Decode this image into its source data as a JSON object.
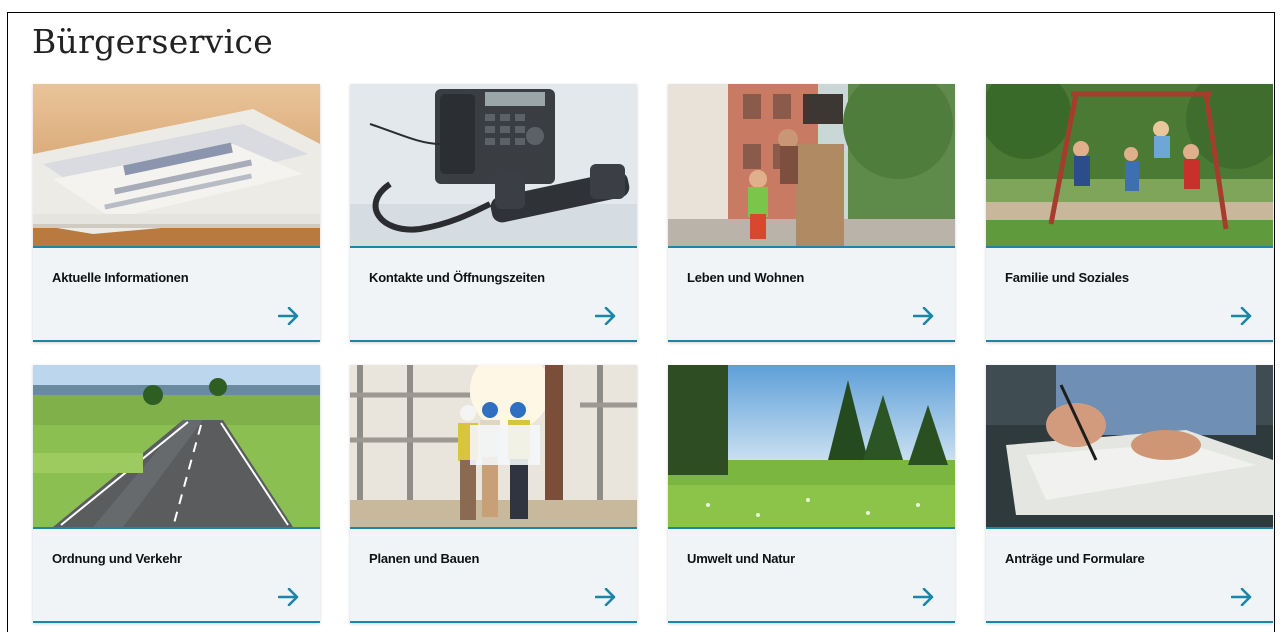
{
  "page": {
    "title": "Bürgerservice"
  },
  "colors": {
    "accent": "#1b86a6",
    "card_bg": "#f0f4f7"
  },
  "cards": [
    {
      "label": "Aktuelle Informationen",
      "icon": "arrow-right-icon"
    },
    {
      "label": "Kontakte und Öffnungszeiten",
      "icon": "arrow-right-icon"
    },
    {
      "label": "Leben und Wohnen",
      "icon": "arrow-right-icon"
    },
    {
      "label": "Familie und Soziales",
      "icon": "arrow-right-icon"
    },
    {
      "label": "Ordnung und Verkehr",
      "icon": "arrow-right-icon"
    },
    {
      "label": "Planen und Bauen",
      "icon": "arrow-right-icon"
    },
    {
      "label": "Umwelt und Natur",
      "icon": "arrow-right-icon"
    },
    {
      "label": "Anträge und Formulare",
      "icon": "arrow-right-icon"
    }
  ]
}
